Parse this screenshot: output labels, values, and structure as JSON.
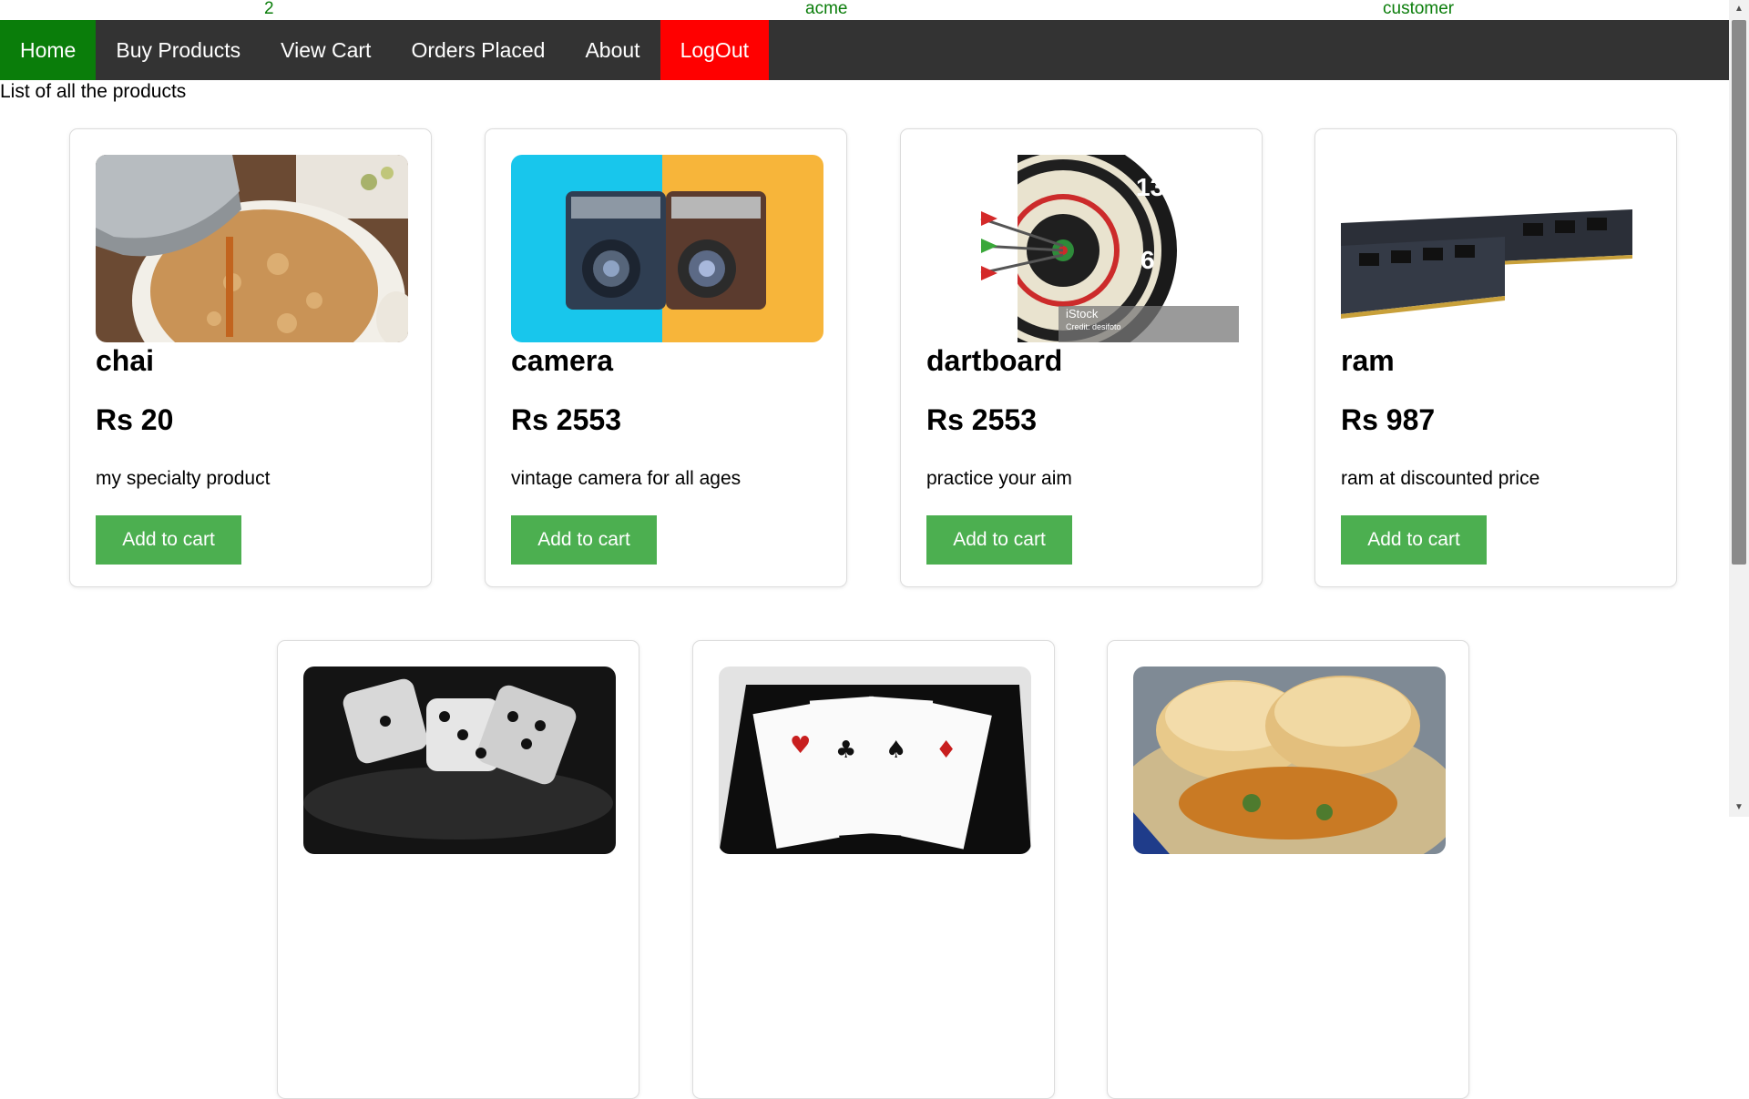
{
  "topinfo": {
    "count": "2",
    "company": "acme",
    "role": "customer"
  },
  "nav": {
    "home": "Home",
    "buy": "Buy Products",
    "cart": "View Cart",
    "orders": "Orders Placed",
    "about": "About",
    "logout": "LogOut"
  },
  "heading": "List of all the products",
  "products": [
    {
      "name": "chai",
      "price": "Rs 20",
      "desc": "my specialty product",
      "button": "Add to cart"
    },
    {
      "name": "camera",
      "price": "Rs 2553",
      "desc": "vintage camera for all ages",
      "button": "Add to cart"
    },
    {
      "name": "dartboard",
      "price": "Rs 2553",
      "desc": "practice your aim",
      "button": "Add to cart"
    },
    {
      "name": "ram",
      "price": "Rs 987",
      "desc": "ram at discounted price",
      "button": "Add to cart"
    }
  ],
  "image_watermark": {
    "brand": "iStock",
    "credit": "Credit: desifoto"
  },
  "colors": {
    "nav_bg": "#333333",
    "active_tab": "#0a7d0a",
    "logout_tab": "#ff0000",
    "button": "#4caf50",
    "topinfo_text": "#0a7d0a"
  }
}
